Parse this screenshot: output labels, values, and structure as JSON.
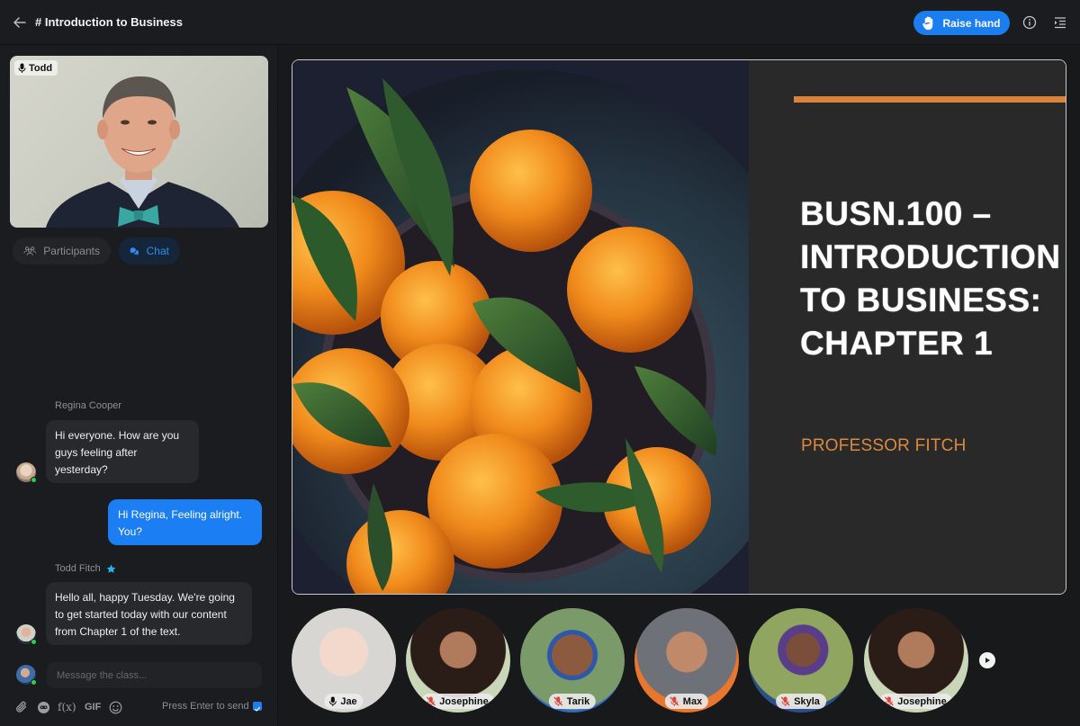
{
  "header": {
    "title": "# Introduction to Business",
    "raise_hand_label": "Raise hand",
    "icons": [
      "back-arrow-icon",
      "raised-hand-icon",
      "info-icon",
      "panel-list-icon"
    ]
  },
  "sidebar": {
    "presenter_video": {
      "name": "Todd",
      "mic": "on"
    },
    "tabs": [
      {
        "label": "Participants",
        "icon": "participants-icon",
        "active": false
      },
      {
        "label": "Chat",
        "icon": "chat-bubbles-icon",
        "active": true
      }
    ],
    "messages": [
      {
        "sender": "Regina Cooper",
        "text": "Hi everyone. How are you guys feeling after yesterday?",
        "lines": [
          "Hi everyone. How are you",
          "guys feeling after",
          "yesterday?"
        ],
        "mine": false,
        "online": true
      },
      {
        "sender": "",
        "text": "Hi Regina, Feeling alright. You?",
        "lines": [
          "Hi Regina, Feeling alright.",
          "You?"
        ],
        "mine": true
      },
      {
        "sender": "Todd Fitch",
        "badge": "star-icon",
        "text": "Hello all, happy Tuesday. We're going to get started today with our content from Chapter 1 of the text.",
        "lines": [
          "Hello all, happy Tuesday. We're going",
          "to get started today with our content",
          "from Chapter 1 of the text."
        ],
        "mine": false,
        "online": true
      }
    ],
    "composer": {
      "placeholder": "Message the class...",
      "tools": [
        "paperclip-icon",
        "sticker-icon",
        "formula-icon",
        "GIF",
        "emoji-icon"
      ],
      "gif_label": "GIF",
      "formula_label": "f(x)",
      "enter_to_send_label": "Press Enter to send",
      "enter_to_send_checked": true
    }
  },
  "stage": {
    "slide_title_lines": [
      "BUSN.100 –",
      "INTRODUCTION",
      "TO BUSINESS:",
      "CHAPTER 1"
    ],
    "slide_subtitle": "PROFESSOR FITCH",
    "accent_color": "#d9833a"
  },
  "participants": [
    {
      "name": "Jae",
      "mic": "on"
    },
    {
      "name": "Josephine",
      "mic": "muted"
    },
    {
      "name": "Tarik",
      "mic": "muted"
    },
    {
      "name": "Max",
      "mic": "muted"
    },
    {
      "name": "Skyla",
      "mic": "muted"
    },
    {
      "name": "Josephine",
      "mic": "muted"
    }
  ],
  "colors": {
    "primary_blue": "#1a7ef0",
    "online_green": "#2ecc55",
    "muted_red": "#e0453a"
  }
}
